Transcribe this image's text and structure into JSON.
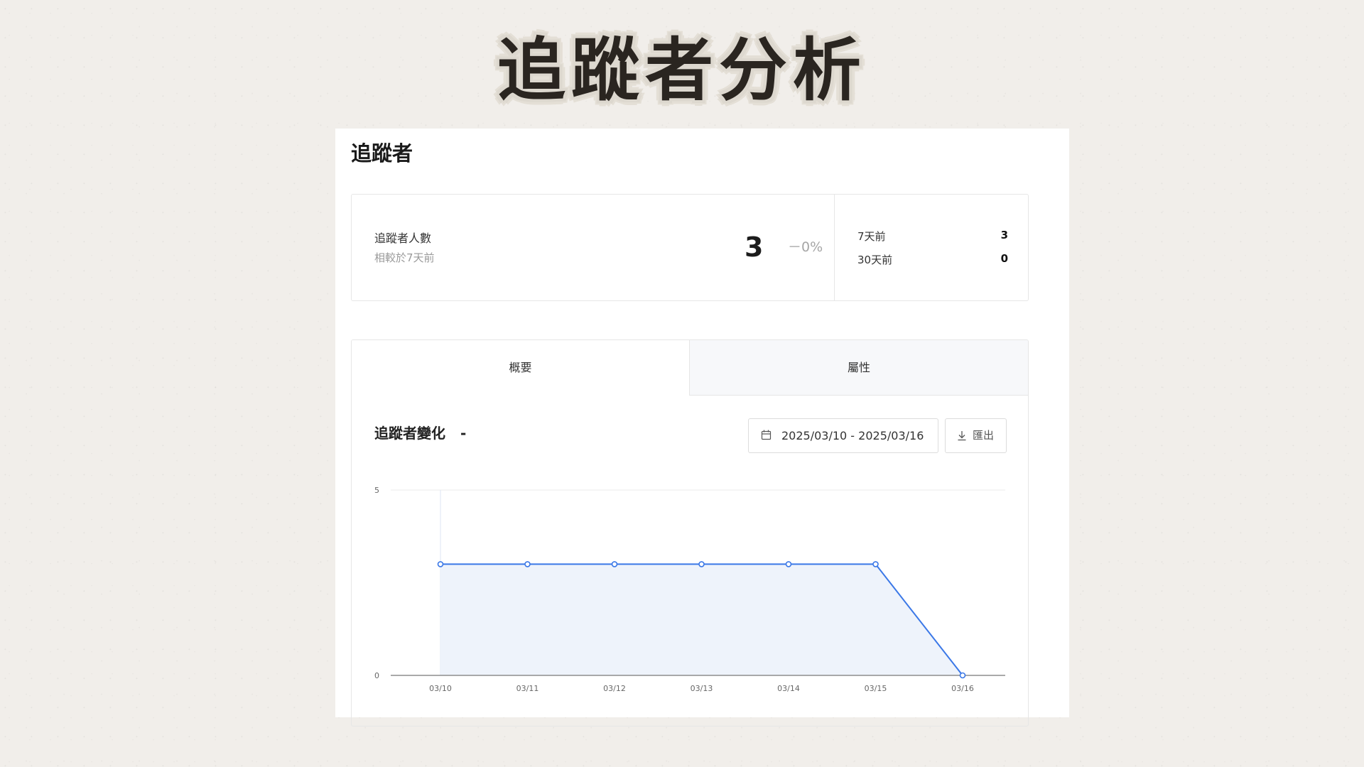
{
  "slide": {
    "title": "追蹤者分析"
  },
  "panel": {
    "title": "追蹤者"
  },
  "summary": {
    "label": "追蹤者人數",
    "sublabel": "相較於7天前",
    "value": "3",
    "change": "－0%",
    "comparisons": [
      {
        "label": "7天前",
        "value": "3"
      },
      {
        "label": "30天前",
        "value": "0"
      }
    ]
  },
  "tabs": [
    {
      "label": "概要",
      "active": true
    },
    {
      "label": "屬性",
      "active": false
    }
  ],
  "chart_section": {
    "title": "追蹤者變化",
    "title_suffix": "-",
    "date_range": "2025/03/10 - 2025/03/16",
    "export_label": "匯出"
  },
  "colors": {
    "line": "#3b78e7",
    "area": "#eef3fb",
    "grid": "#ebebeb",
    "axis": "#777777"
  },
  "chart_data": {
    "type": "area",
    "x": [
      "03/10",
      "03/11",
      "03/12",
      "03/13",
      "03/14",
      "03/15",
      "03/16"
    ],
    "series": [
      {
        "values": [
          3,
          3,
          3,
          3,
          3,
          3,
          0
        ]
      }
    ],
    "ylim": [
      0,
      5
    ],
    "yticks": [
      "0",
      "5"
    ],
    "grid": true,
    "legend": "none"
  }
}
